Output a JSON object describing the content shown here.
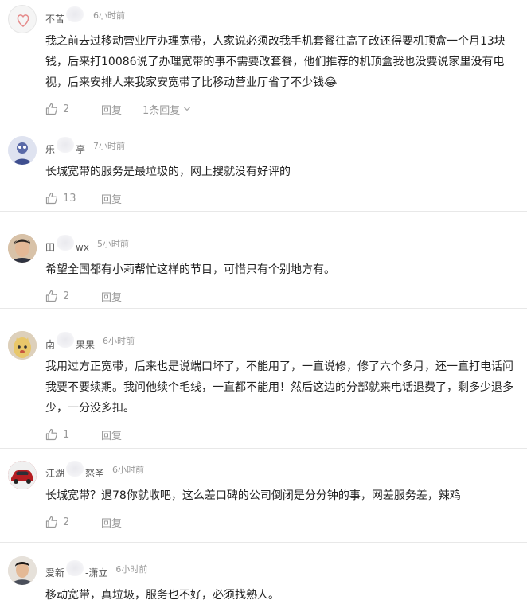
{
  "comments": [
    {
      "user_visible_start": "不苦",
      "user_visible_end": "",
      "time": "6小时前",
      "text": "我之前去过移动营业厅办理宽带，人家说必须改我手机套餐往高了改还得要机顶盒一个月13块钱，后来打10086说了办理宽带的事不需要改套餐，他们推荐的机顶盒我也没要说家里没有电视，后来安排人来我家安宽带了比移动营业厅省了不少钱😂",
      "likes": "2",
      "reply_label": "回复",
      "replies_label": "1条回复"
    },
    {
      "user_visible_start": "乐",
      "user_visible_end": "亭",
      "time": "7小时前",
      "text": "长城宽带的服务是最垃圾的，网上搜就没有好评的",
      "likes": "13",
      "reply_label": "回复"
    },
    {
      "user_visible_start": "田",
      "user_visible_end": "wx",
      "time": "5小时前",
      "text": "希望全国都有小莉帮忙这样的节目，可惜只有个别地方有。",
      "likes": "2",
      "reply_label": "回复"
    },
    {
      "user_visible_start": "南",
      "user_visible_end": "果果",
      "time": "6小时前",
      "text": "我用过方正宽带，后来也是说端口坏了，不能用了，一直说修，修了六个多月，还一直打电话问我要不要续期。我问他续个毛线，一直都不能用！然后这边的分部就来电话退费了，剩多少退多少，一分没多扣。",
      "likes": "1",
      "reply_label": "回复"
    },
    {
      "user_visible_start": "江湖",
      "user_visible_end": "怒圣",
      "time": "6小时前",
      "text": "长城宽带？退78你就收吧，这么差口碑的公司倒闭是分分钟的事，网差服务差，辣鸡",
      "likes": "2",
      "reply_label": "回复"
    },
    {
      "user_visible_start": "爱新",
      "user_visible_end": "-潇立",
      "time": "6小时前",
      "text": "移动宽带，真垃圾，服务也不好，必须找熟人。"
    }
  ],
  "icons": {
    "like": "thumbs-up-icon",
    "expand": "chevron-down-icon"
  },
  "colors": {
    "text": "#222222",
    "muted": "#999999",
    "divider": "#e8e8e8"
  }
}
